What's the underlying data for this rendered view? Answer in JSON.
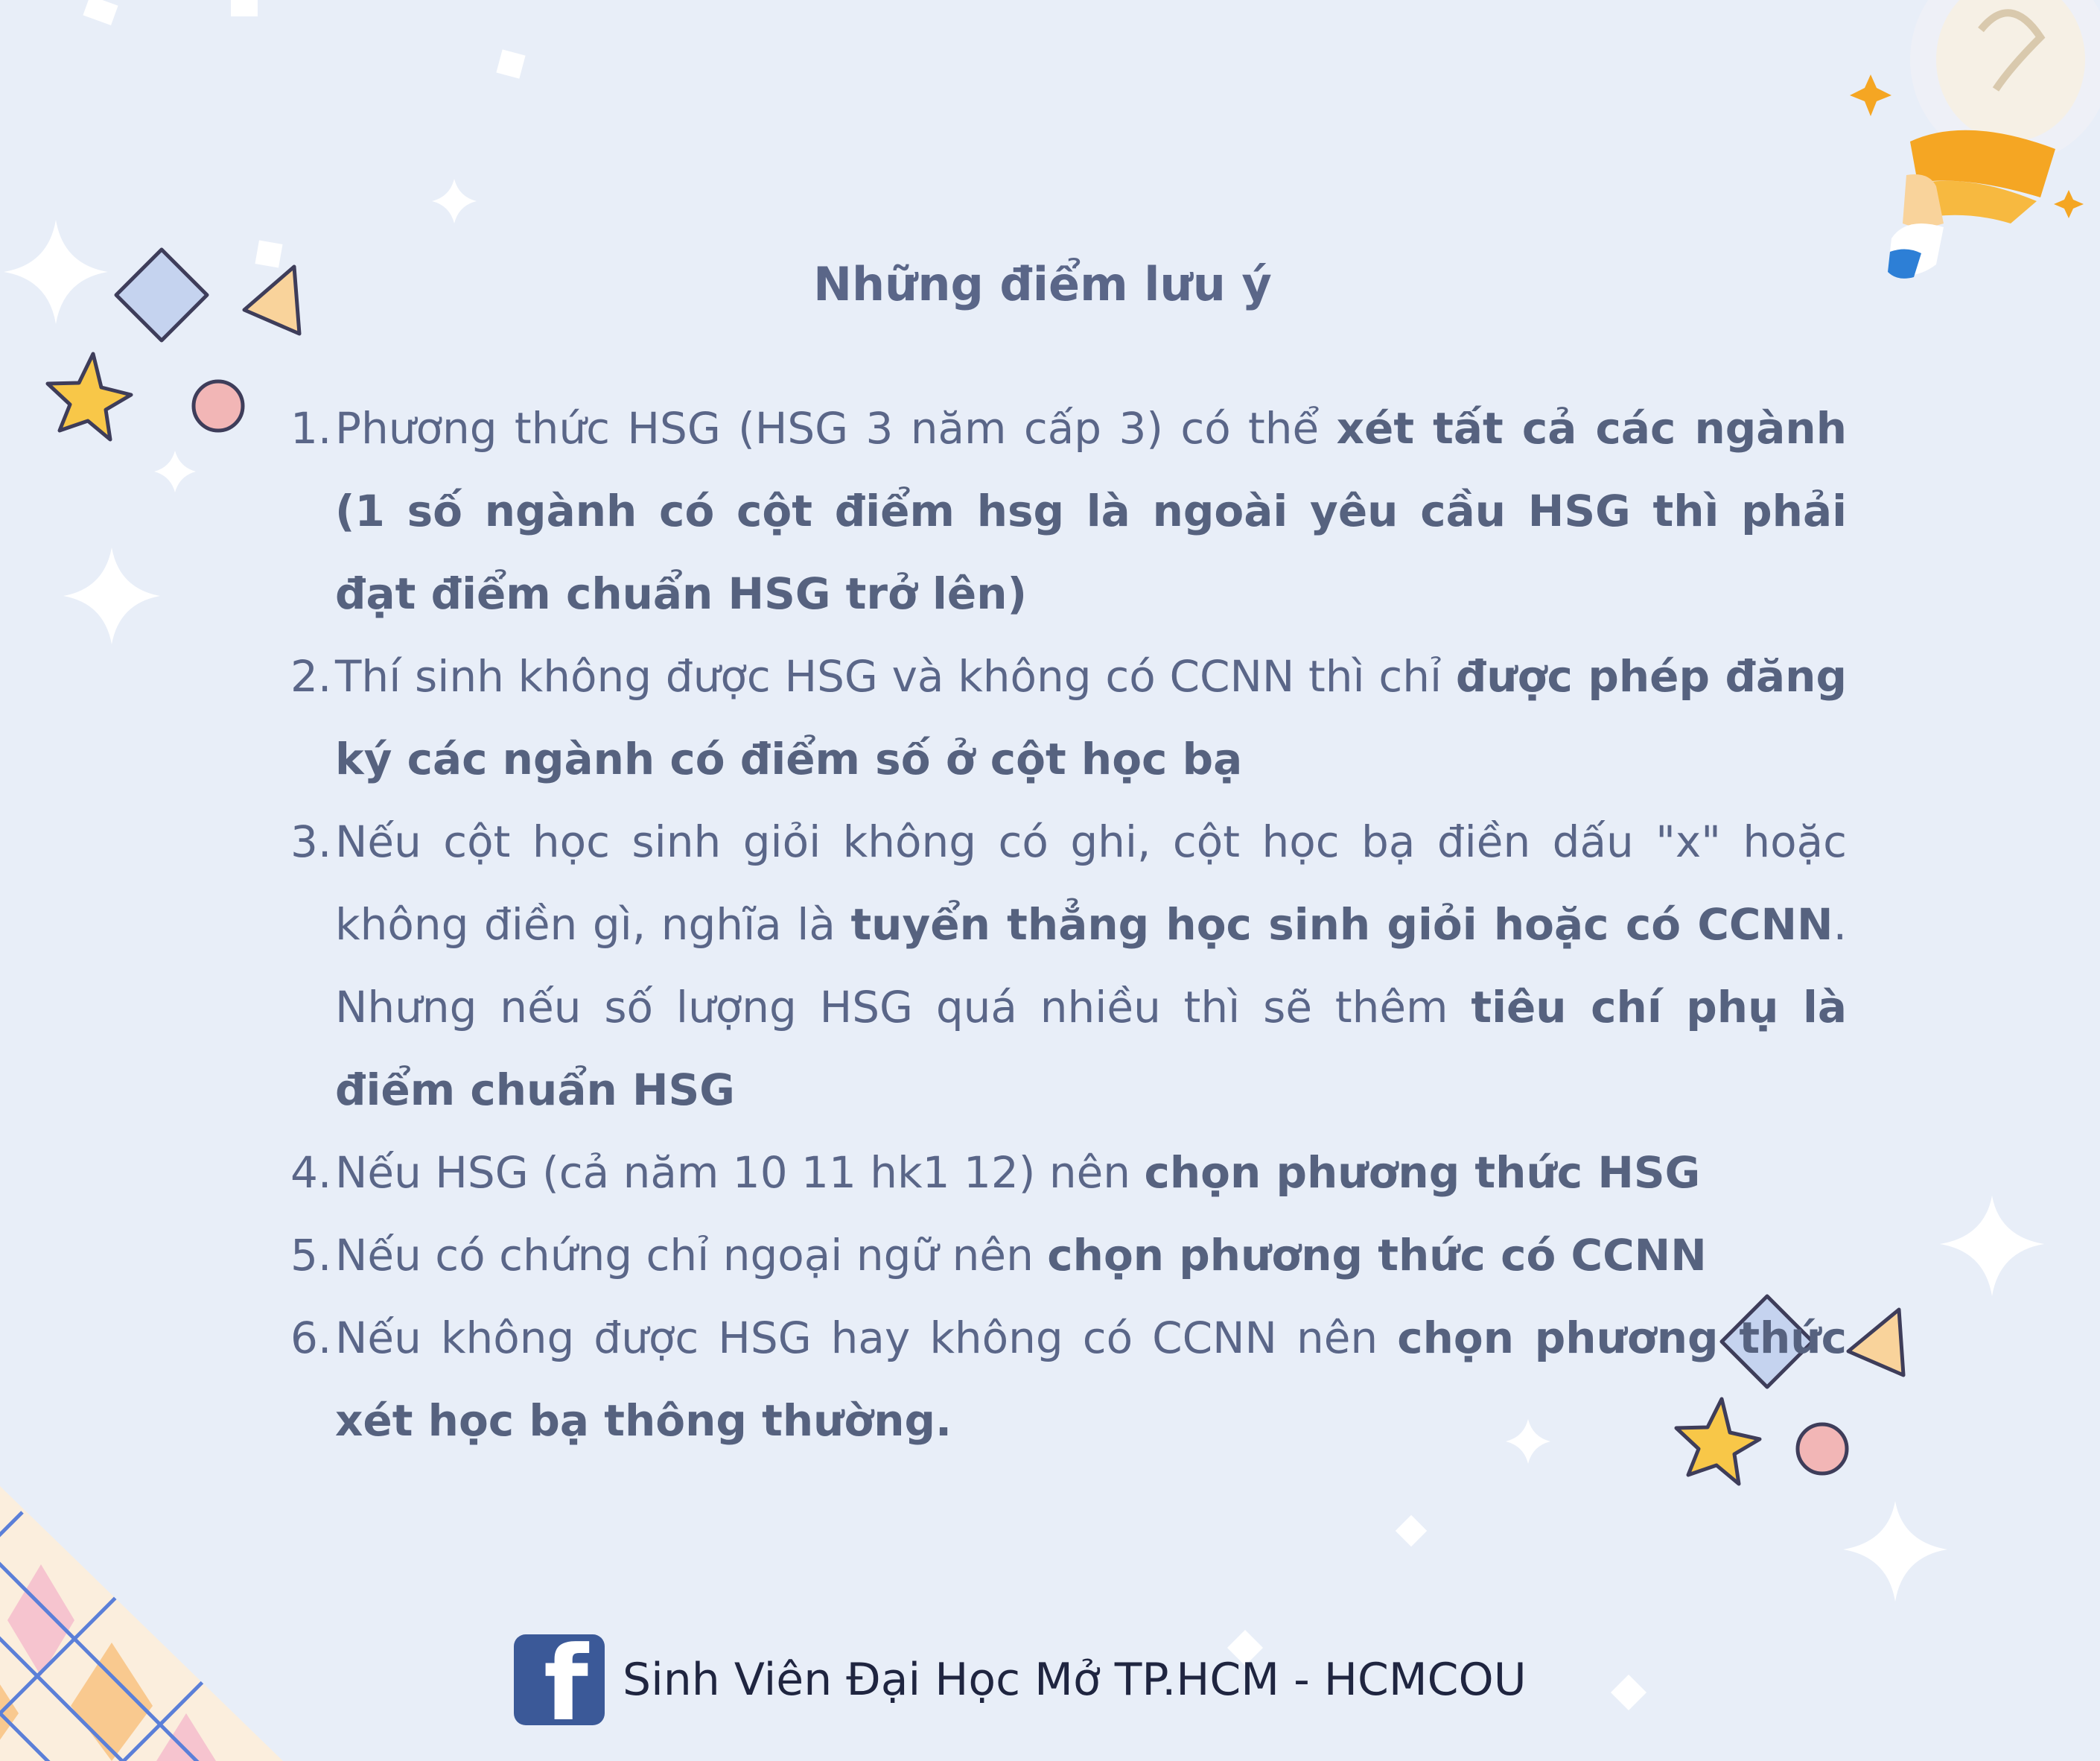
{
  "title": "Những điểm lưu ý",
  "notes": [
    {
      "num": "1.",
      "parts": [
        {
          "t": "Phương thức HSG (HSG 3 năm cấp 3) có thể ",
          "b": false
        },
        {
          "t": "xét tất cả các ngành (1 số ngành có cột điểm hsg là ngoài yêu cầu HSG thì phải đạt điểm chuẩn HSG trở lên)",
          "b": true
        }
      ]
    },
    {
      "num": "2.",
      "parts": [
        {
          "t": "Thí sinh không được HSG và không có CCNN thì chỉ ",
          "b": false
        },
        {
          "t": "được phép đăng ký các ngành có điểm số ở cột học bạ",
          "b": true
        }
      ]
    },
    {
      "num": "3.",
      "parts": [
        {
          "t": "Nếu cột học sinh giỏi không có ghi, cột học bạ điền dấu \"x\" hoặc không điền gì, nghĩa là ",
          "b": false
        },
        {
          "t": "tuyển thẳng học sinh giỏi hoặc có CCNN",
          "b": true
        },
        {
          "t": ". Nhưng nếu số lượng HSG quá nhiều thì sẽ thêm ",
          "b": false
        },
        {
          "t": "tiêu chí phụ là điểm chuẩn HSG",
          "b": true
        }
      ]
    },
    {
      "num": "4.",
      "parts": [
        {
          "t": "Nếu HSG (cả năm 10 11 hk1 12) nên ",
          "b": false
        },
        {
          "t": "chọn phương thức HSG",
          "b": true
        }
      ]
    },
    {
      "num": "5.",
      "parts": [
        {
          "t": "Nếu có chứng chỉ ngoại ngữ nên ",
          "b": false
        },
        {
          "t": "chọn phương thức có CCNN",
          "b": true
        }
      ]
    },
    {
      "num": "6.",
      "parts": [
        {
          "t": "Nếu không được HSG hay không có CCNN nên ",
          "b": false
        },
        {
          "t": "chọn phương thức xét học bạ thông thường.",
          "b": true
        }
      ]
    }
  ],
  "footer": {
    "icon": "facebook-icon",
    "icon_glyph": "f",
    "text": "Sinh Viên Đại Học Mở TP.HCM - HCMCOU"
  },
  "colors": {
    "background": "#e8eef8",
    "text": "#5a6688",
    "footer_text": "#1f2540",
    "facebook": "#3b5998"
  }
}
